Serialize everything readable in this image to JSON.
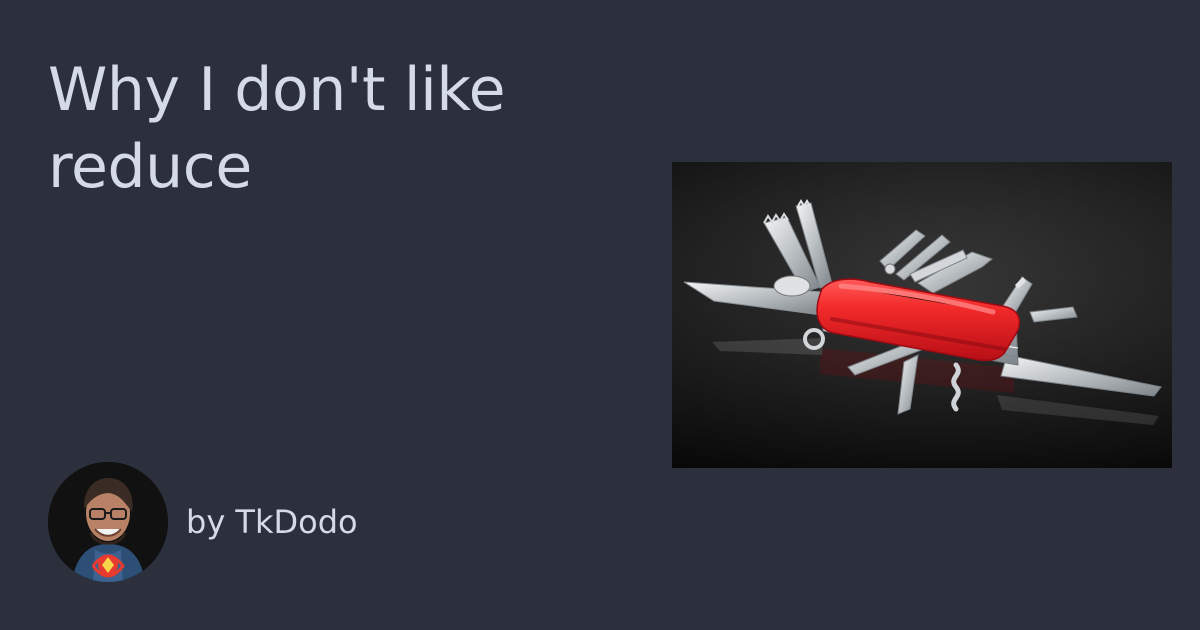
{
  "post": {
    "title": "Why I don't like reduce",
    "byline": "by TkDodo"
  },
  "hero_image": {
    "subject": "swiss-army-knife"
  },
  "author": {
    "avatar_subject": "author-avatar"
  },
  "colors": {
    "background": "#2b303c",
    "title_text": "#d5dbe6",
    "byline_text": "#d5dbe6",
    "knife_red": "#e82626",
    "steel": "#cfd3d6"
  }
}
